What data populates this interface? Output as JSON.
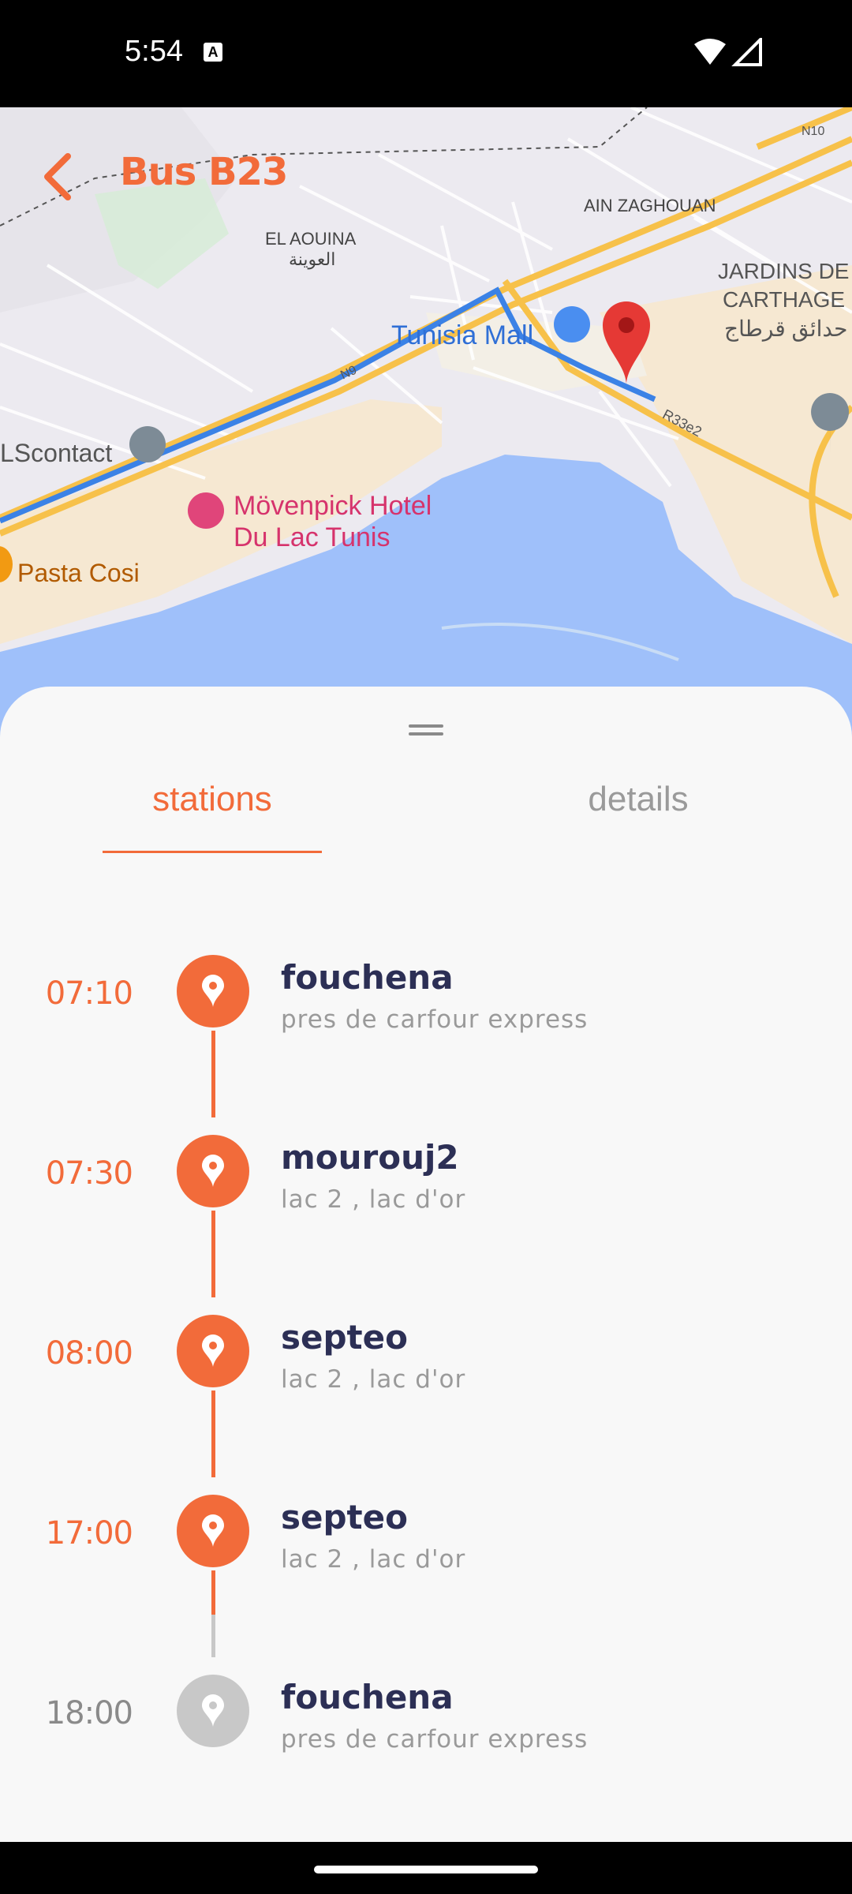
{
  "status_bar": {
    "time": "5:54",
    "notification_icon": "A"
  },
  "header": {
    "title": "Bus B23",
    "back_icon": "chevron-left-icon"
  },
  "map": {
    "labels": {
      "el_aouina": "EL AOUINA",
      "el_aouina_ar": "العوينة",
      "ain_zaghouan": "AIN ZAGHOUAN",
      "jardins_1": "JARDINS DE",
      "jardins_2": "CARTHAGE",
      "jardins_ar": "حدائق قرطاج",
      "tunisia_mall": "Tunisia Mall",
      "scontact": "LScontact",
      "movenpick_1": "Mövenpick Hotel",
      "movenpick_2": "Du Lac Tunis",
      "pasta_cosi": "Pasta Cosi",
      "road_n9": "N9",
      "road_n10": "N10",
      "road_r33e2": "R33e2"
    },
    "colors": {
      "water": "#9fc0fa",
      "land": "#eceaf0",
      "beige": "#f6e8d2",
      "green": "#cfe8d2",
      "road": "#f7c14a",
      "route": "#3b82e6",
      "pin": "#e53935"
    }
  },
  "tabs": {
    "stations": "stations",
    "details": "details",
    "active": "stations"
  },
  "accent_color": "#f26b3a",
  "stops": [
    {
      "time": "07:10",
      "name": "fouchena",
      "description": "pres de carfour express",
      "active": true
    },
    {
      "time": "07:30",
      "name": "mourouj2",
      "description": "lac 2 , lac d'or",
      "active": true
    },
    {
      "time": "08:00",
      "name": "septeo",
      "description": "lac 2 , lac d'or",
      "active": true
    },
    {
      "time": "17:00",
      "name": "septeo",
      "description": "lac 2 , lac d'or",
      "active": true
    },
    {
      "time": "18:00",
      "name": "fouchena",
      "description": "pres de carfour express",
      "active": false
    }
  ]
}
